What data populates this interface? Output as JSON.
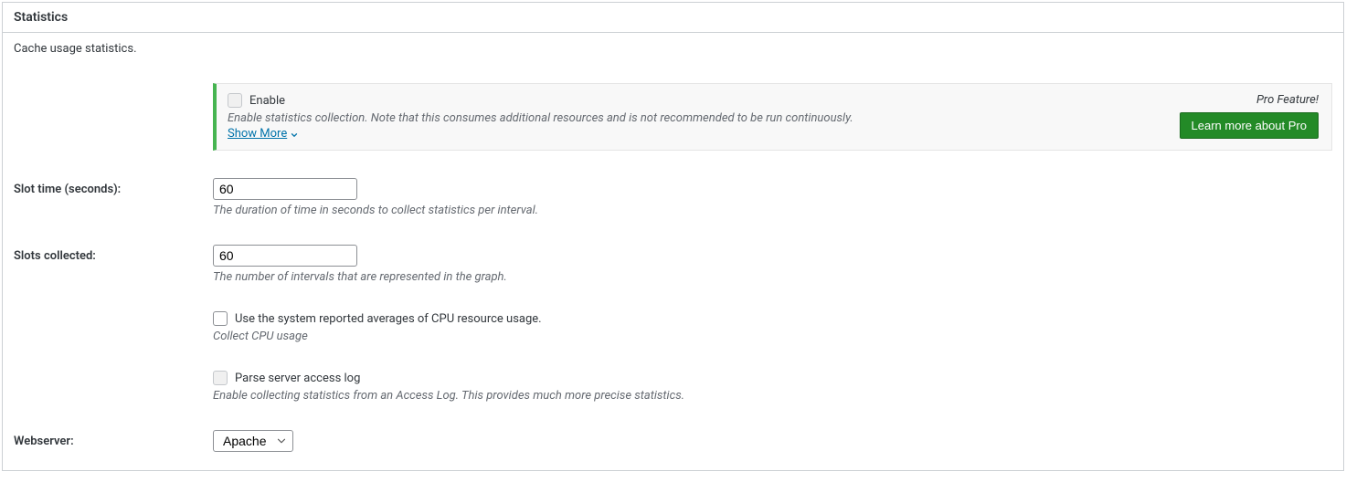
{
  "panel": {
    "title": "Statistics",
    "intro": "Cache usage statistics."
  },
  "pro_notice": {
    "enable_label": "Enable",
    "description": "Enable statistics collection. Note that this consumes additional resources and is not recommended to be run continuously.",
    "show_more": "Show More",
    "pro_feature": "Pro Feature!",
    "learn_more_btn": "Learn more about Pro"
  },
  "slot_time": {
    "label": "Slot time (seconds):",
    "value": "60",
    "description": "The duration of time in seconds to collect statistics per interval."
  },
  "slots_collected": {
    "label": "Slots collected:",
    "value": "60",
    "description": "The number of intervals that are represented in the graph."
  },
  "cpu_usage": {
    "checkbox_label": "Use the system reported averages of CPU resource usage.",
    "description": "Collect CPU usage"
  },
  "access_log": {
    "checkbox_label": "Parse server access log",
    "description": "Enable collecting statistics from an Access Log. This provides much more precise statistics."
  },
  "webserver": {
    "label": "Webserver:",
    "selected": "Apache"
  }
}
